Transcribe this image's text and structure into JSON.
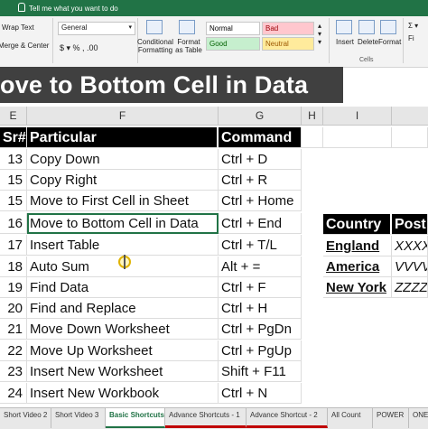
{
  "ribbon": {
    "tell_me": "Tell me what you want to do",
    "wrap_text": "Wrap Text",
    "merge_center": "Merge & Center",
    "number_format": "General",
    "conditional_formatting": "Conditional Formatting",
    "format_as_table": "Format as Table",
    "styles": {
      "normal": "Normal",
      "bad": "Bad",
      "good": "Good",
      "neutral": "Neutral"
    },
    "insert": "Insert",
    "delete": "Delete",
    "format": "Format",
    "cells_group": "Cells",
    "fill_partial": "Fi"
  },
  "banner": {
    "text": "ove to Bottom Cell in Data"
  },
  "columns": [
    "E",
    "F",
    "G",
    "H",
    "I"
  ],
  "table": {
    "headers": {
      "sr": "Sr#",
      "particular": "Particular",
      "command": "Command"
    },
    "rows": [
      {
        "sr": "13",
        "particular": "Copy Down",
        "command": "Ctrl + D"
      },
      {
        "sr": "15",
        "particular": "Copy Right",
        "command": "Ctrl + R"
      },
      {
        "sr": "15",
        "particular": "Move to First Cell in Sheet",
        "command": "Ctrl + Home"
      },
      {
        "sr": "16",
        "particular": "Move to Bottom Cell in Data",
        "command": "Ctrl + End"
      },
      {
        "sr": "17",
        "particular": "Insert Table",
        "command": "Ctrl + T/L"
      },
      {
        "sr": "18",
        "particular": "Auto Sum",
        "command": "Alt + ="
      },
      {
        "sr": "19",
        "particular": "Find Data",
        "command": "Ctrl + F"
      },
      {
        "sr": "20",
        "particular": "Find and Replace",
        "command": "Ctrl + H"
      },
      {
        "sr": "21",
        "particular": "Move Down Worksheet",
        "command": "Ctrl + PgDn"
      },
      {
        "sr": "22",
        "particular": "Move Up Worksheet",
        "command": "Ctrl + PgUp"
      },
      {
        "sr": "23",
        "particular": "Insert New Worksheet",
        "command": "Shift + F11"
      },
      {
        "sr": "24",
        "particular": "Insert New Workbook",
        "command": "Ctrl + N"
      }
    ]
  },
  "side_table": {
    "headers": {
      "country": "Country",
      "post": "Post"
    },
    "rows": [
      {
        "country": "England",
        "post": "XXXX"
      },
      {
        "country": "America",
        "post": "VVVV"
      },
      {
        "country": "New York",
        "post": "ZZZZ"
      }
    ]
  },
  "sheet_tabs": [
    "Short Video 2",
    "Short Video 3",
    "Basic Shortcuts",
    "Advance Shortcuts - 1",
    "Advance Shortcut - 2",
    "All Count",
    "POWER",
    "ONE PAG"
  ],
  "active_tab": "Basic Shortcuts"
}
